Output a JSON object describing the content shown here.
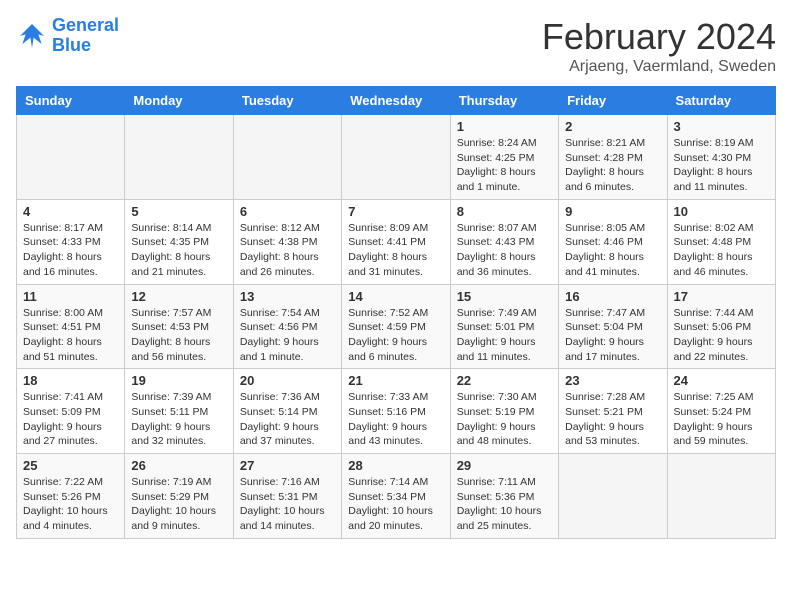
{
  "header": {
    "logo_line1": "General",
    "logo_line2": "Blue",
    "title": "February 2024",
    "subtitle": "Arjaeng, Vaermland, Sweden"
  },
  "calendar": {
    "days_of_week": [
      "Sunday",
      "Monday",
      "Tuesday",
      "Wednesday",
      "Thursday",
      "Friday",
      "Saturday"
    ],
    "weeks": [
      [
        {
          "date": "",
          "info": ""
        },
        {
          "date": "",
          "info": ""
        },
        {
          "date": "",
          "info": ""
        },
        {
          "date": "",
          "info": ""
        },
        {
          "date": "1",
          "info": "Sunrise: 8:24 AM\nSunset: 4:25 PM\nDaylight: 8 hours and 1 minute."
        },
        {
          "date": "2",
          "info": "Sunrise: 8:21 AM\nSunset: 4:28 PM\nDaylight: 8 hours and 6 minutes."
        },
        {
          "date": "3",
          "info": "Sunrise: 8:19 AM\nSunset: 4:30 PM\nDaylight: 8 hours and 11 minutes."
        }
      ],
      [
        {
          "date": "4",
          "info": "Sunrise: 8:17 AM\nSunset: 4:33 PM\nDaylight: 8 hours and 16 minutes."
        },
        {
          "date": "5",
          "info": "Sunrise: 8:14 AM\nSunset: 4:35 PM\nDaylight: 8 hours and 21 minutes."
        },
        {
          "date": "6",
          "info": "Sunrise: 8:12 AM\nSunset: 4:38 PM\nDaylight: 8 hours and 26 minutes."
        },
        {
          "date": "7",
          "info": "Sunrise: 8:09 AM\nSunset: 4:41 PM\nDaylight: 8 hours and 31 minutes."
        },
        {
          "date": "8",
          "info": "Sunrise: 8:07 AM\nSunset: 4:43 PM\nDaylight: 8 hours and 36 minutes."
        },
        {
          "date": "9",
          "info": "Sunrise: 8:05 AM\nSunset: 4:46 PM\nDaylight: 8 hours and 41 minutes."
        },
        {
          "date": "10",
          "info": "Sunrise: 8:02 AM\nSunset: 4:48 PM\nDaylight: 8 hours and 46 minutes."
        }
      ],
      [
        {
          "date": "11",
          "info": "Sunrise: 8:00 AM\nSunset: 4:51 PM\nDaylight: 8 hours and 51 minutes."
        },
        {
          "date": "12",
          "info": "Sunrise: 7:57 AM\nSunset: 4:53 PM\nDaylight: 8 hours and 56 minutes."
        },
        {
          "date": "13",
          "info": "Sunrise: 7:54 AM\nSunset: 4:56 PM\nDaylight: 9 hours and 1 minute."
        },
        {
          "date": "14",
          "info": "Sunrise: 7:52 AM\nSunset: 4:59 PM\nDaylight: 9 hours and 6 minutes."
        },
        {
          "date": "15",
          "info": "Sunrise: 7:49 AM\nSunset: 5:01 PM\nDaylight: 9 hours and 11 minutes."
        },
        {
          "date": "16",
          "info": "Sunrise: 7:47 AM\nSunset: 5:04 PM\nDaylight: 9 hours and 17 minutes."
        },
        {
          "date": "17",
          "info": "Sunrise: 7:44 AM\nSunset: 5:06 PM\nDaylight: 9 hours and 22 minutes."
        }
      ],
      [
        {
          "date": "18",
          "info": "Sunrise: 7:41 AM\nSunset: 5:09 PM\nDaylight: 9 hours and 27 minutes."
        },
        {
          "date": "19",
          "info": "Sunrise: 7:39 AM\nSunset: 5:11 PM\nDaylight: 9 hours and 32 minutes."
        },
        {
          "date": "20",
          "info": "Sunrise: 7:36 AM\nSunset: 5:14 PM\nDaylight: 9 hours and 37 minutes."
        },
        {
          "date": "21",
          "info": "Sunrise: 7:33 AM\nSunset: 5:16 PM\nDaylight: 9 hours and 43 minutes."
        },
        {
          "date": "22",
          "info": "Sunrise: 7:30 AM\nSunset: 5:19 PM\nDaylight: 9 hours and 48 minutes."
        },
        {
          "date": "23",
          "info": "Sunrise: 7:28 AM\nSunset: 5:21 PM\nDaylight: 9 hours and 53 minutes."
        },
        {
          "date": "24",
          "info": "Sunrise: 7:25 AM\nSunset: 5:24 PM\nDaylight: 9 hours and 59 minutes."
        }
      ],
      [
        {
          "date": "25",
          "info": "Sunrise: 7:22 AM\nSunset: 5:26 PM\nDaylight: 10 hours and 4 minutes."
        },
        {
          "date": "26",
          "info": "Sunrise: 7:19 AM\nSunset: 5:29 PM\nDaylight: 10 hours and 9 minutes."
        },
        {
          "date": "27",
          "info": "Sunrise: 7:16 AM\nSunset: 5:31 PM\nDaylight: 10 hours and 14 minutes."
        },
        {
          "date": "28",
          "info": "Sunrise: 7:14 AM\nSunset: 5:34 PM\nDaylight: 10 hours and 20 minutes."
        },
        {
          "date": "29",
          "info": "Sunrise: 7:11 AM\nSunset: 5:36 PM\nDaylight: 10 hours and 25 minutes."
        },
        {
          "date": "",
          "info": ""
        },
        {
          "date": "",
          "info": ""
        }
      ]
    ]
  }
}
